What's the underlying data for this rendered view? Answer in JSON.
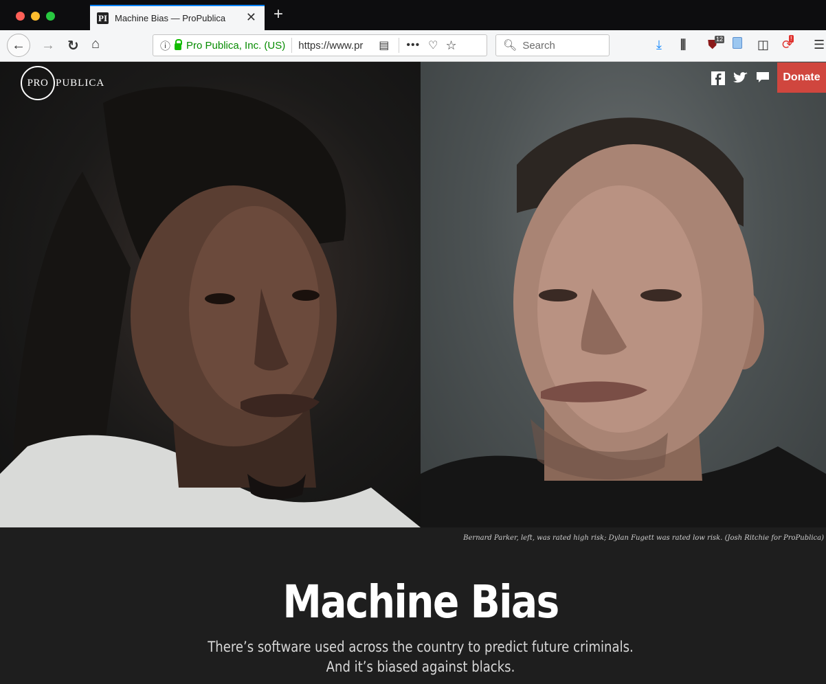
{
  "browser": {
    "tab_title": "Machine Bias — ProPublica",
    "tab_favicon": "PI",
    "new_tab_label": "+",
    "close_label": "✕",
    "url_org": "Pro Publica, Inc. (US)",
    "url": "https://www.propublica.org/article/machine-bias-risk-assessments-in-criminal-sentencing",
    "search_placeholder": "Search",
    "badges": {
      "ublock": "12",
      "notification": "!"
    }
  },
  "site": {
    "logo_circle": "PRO",
    "logo_rest": "PUBLICA",
    "donate_label": "Donate"
  },
  "article": {
    "caption": "Bernard Parker, left, was rated high risk; Dylan Fugett was rated low risk. (Josh Ritchie for ProPublica)",
    "headline": "Machine Bias",
    "deck_line1": "There’s software used across the country to predict future criminals.",
    "deck_line2": "And it’s biased against blacks."
  },
  "colors": {
    "accent": "#0a84ff",
    "donate": "#d0463e",
    "secure_green": "#058b00",
    "page_bg": "#1e1e1e"
  }
}
